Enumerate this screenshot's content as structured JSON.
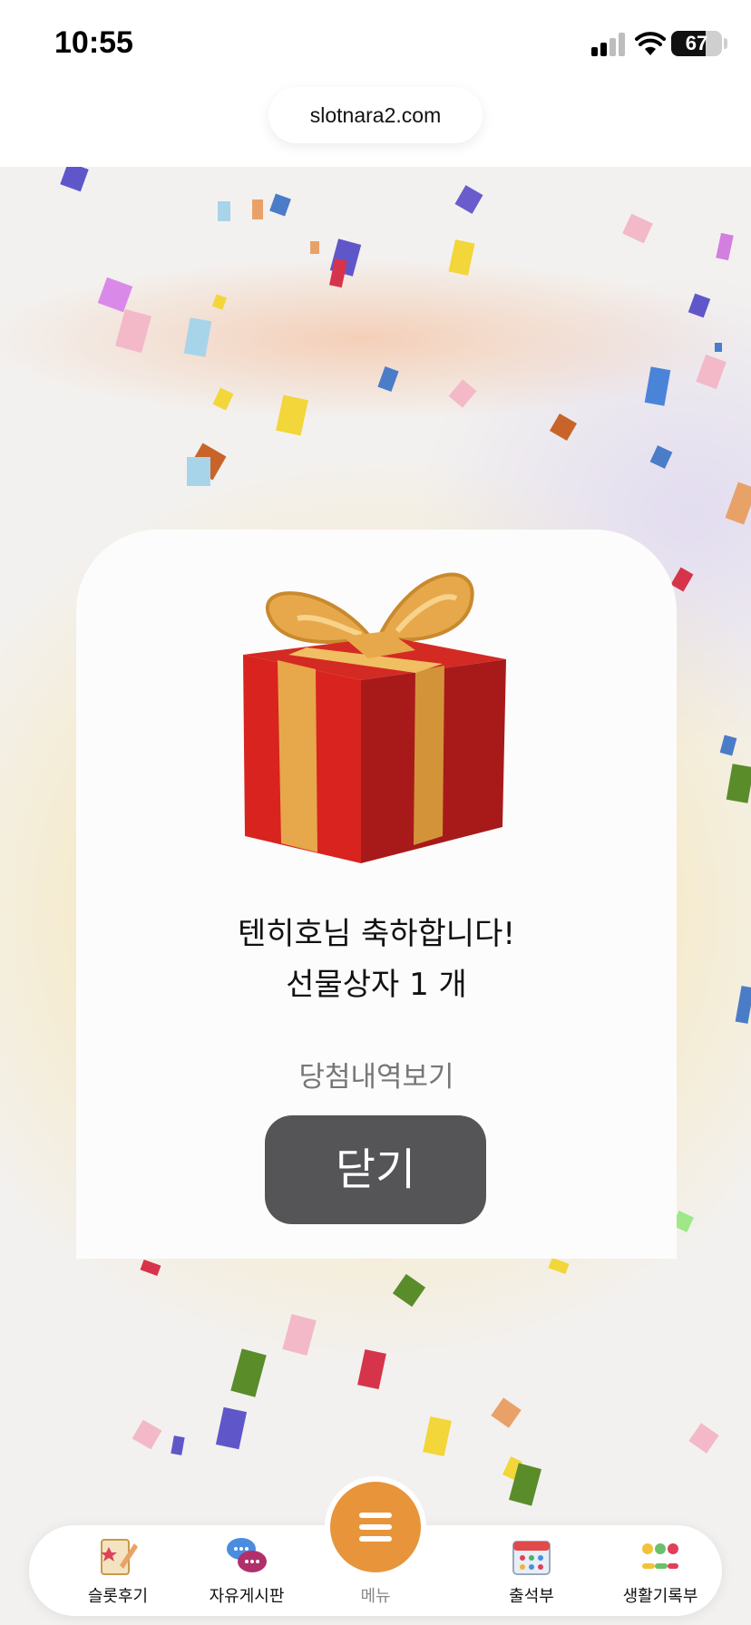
{
  "status_bar": {
    "time": "10:55",
    "battery": "67"
  },
  "browser": {
    "url": "slotnara2.com"
  },
  "modal": {
    "line1": "텐히호님 축하합니다!",
    "line2": "선물상자 1 개",
    "history_link": "당첨내역보기",
    "close_label": "닫기",
    "gift_icon": "gift-box-icon"
  },
  "bottom_nav": {
    "items": [
      {
        "label": "슬롯후기",
        "icon": "review-pencil-icon"
      },
      {
        "label": "자유게시판",
        "icon": "chat-bubbles-icon"
      },
      {
        "label": "메뉴",
        "icon": "menu-icon"
      },
      {
        "label": "출석부",
        "icon": "calendar-icon"
      },
      {
        "label": "생활기록부",
        "icon": "emoji-record-icon"
      }
    ]
  },
  "colors": {
    "accent": "#e8943a",
    "close_button": "#555456",
    "gift_red": "#c8201f",
    "ribbon_gold": "#e6a84a"
  }
}
